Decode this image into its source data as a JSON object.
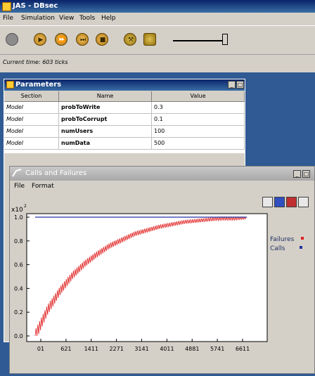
{
  "main_window": {
    "title": "JAS - DBsec",
    "menu": [
      "File",
      "Simulation",
      "View",
      "Tools",
      "Help"
    ],
    "toolbar": {
      "buttons": [
        {
          "name": "stop",
          "icon": "stop-circle-icon",
          "color": "#909090"
        },
        {
          "name": "play",
          "icon": "play-icon",
          "color": "#c8901a"
        },
        {
          "name": "fast-forward",
          "icon": "fast-forward-icon",
          "color": "#c8901a"
        },
        {
          "name": "step",
          "icon": "step-icon",
          "color": "#c8901a"
        },
        {
          "name": "pause",
          "icon": "pause-icon",
          "color": "#c8901a"
        },
        {
          "name": "settings",
          "icon": "tools-icon",
          "color": "#b08a20"
        },
        {
          "name": "database",
          "icon": "database-icon",
          "color": "#b08a20"
        }
      ]
    },
    "status": "Current time: 603 ticks"
  },
  "parameters_window": {
    "title": "Parameters",
    "columns": [
      "Section",
      "Name",
      "Value"
    ],
    "rows": [
      {
        "section": "Model",
        "name": "probToWrite",
        "value": "0.3"
      },
      {
        "section": "Model",
        "name": "probToCorrupt",
        "value": "0.1"
      },
      {
        "section": "Model",
        "name": "numUsers",
        "value": "100"
      },
      {
        "section": "Model",
        "name": "numData",
        "value": "500"
      }
    ]
  },
  "calls_window": {
    "title": "Calls and Failures",
    "menu": [
      "File",
      "Format"
    ],
    "toolbar_icons": [
      "save-icon",
      "copy-icon",
      "export-icon",
      "zoom-icon"
    ]
  },
  "chart_data": {
    "type": "line",
    "title": "",
    "xlabel": "",
    "ylabel": "",
    "y_scale_label": "x10",
    "y_scale_exponent": "2",
    "ylim": [
      0.0,
      1.0
    ],
    "y_ticks": [
      "0.0",
      "0.2",
      "0.4",
      "0.6",
      "0.8",
      "1.0"
    ],
    "x_ticks": [
      "01",
      "621",
      "1411",
      "2271",
      "3141",
      "4011",
      "4881",
      "5741",
      "6611"
    ],
    "legend_position": "right",
    "series": [
      {
        "name": "Failures",
        "color": "#e02020",
        "x": [
          0,
          400,
          800,
          1200,
          1600,
          2000,
          2400,
          2800,
          3200,
          3600,
          4000,
          4400,
          4800,
          5200,
          5600,
          6000,
          6400,
          6800
        ],
        "values": [
          0.0,
          0.22,
          0.38,
          0.51,
          0.61,
          0.69,
          0.76,
          0.81,
          0.86,
          0.89,
          0.92,
          0.94,
          0.96,
          0.97,
          0.98,
          0.99,
          0.99,
          1.0
        ]
      },
      {
        "name": "Calls",
        "color": "#2030a0",
        "x": [
          0,
          6800
        ],
        "values": [
          1.0,
          1.0
        ]
      }
    ]
  }
}
